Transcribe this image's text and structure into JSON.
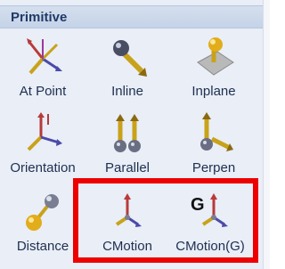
{
  "panel": {
    "title": "Primitive",
    "tools": [
      {
        "label": "At Point",
        "icon": "at-point-icon"
      },
      {
        "label": "Inline",
        "icon": "inline-icon"
      },
      {
        "label": "Inplane",
        "icon": "inplane-icon"
      },
      {
        "label": "Orientation",
        "icon": "orientation-icon"
      },
      {
        "label": "Parallel",
        "icon": "parallel-icon"
      },
      {
        "label": "Perpen",
        "icon": "perpen-icon"
      },
      {
        "label": "Distance",
        "icon": "distance-icon"
      },
      {
        "label": "CMotion",
        "icon": "cmotion-icon"
      },
      {
        "label": "CMotion(G)",
        "icon": "cmotion-g-icon",
        "badge": "G"
      }
    ]
  },
  "highlight_color": "#ee0000"
}
